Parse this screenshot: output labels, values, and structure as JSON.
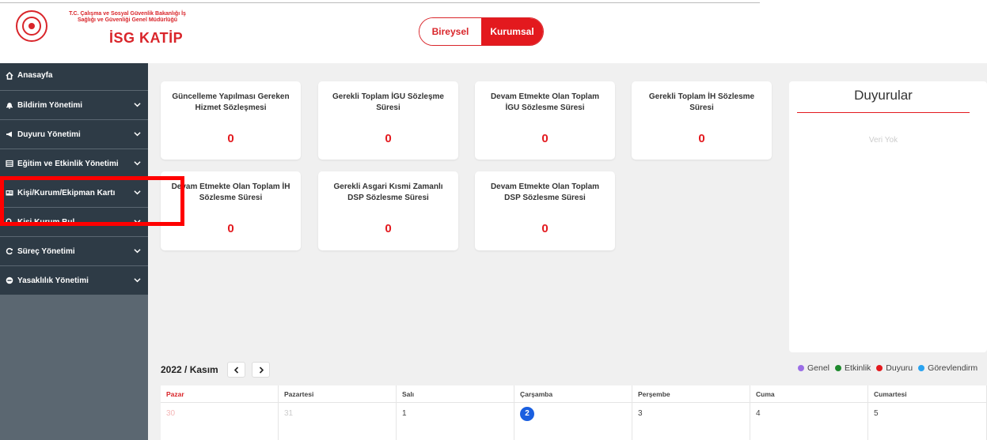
{
  "header": {
    "ministry_line1": "T.C. Çalışma ve Sosyal Güvenlik Bakanlığı İş",
    "ministry_line2": "Sağlığı ve Güvenliği Genel Müdürlüğü",
    "brand": "İSG KATİP",
    "switch": {
      "option1": "Bireysel",
      "option2": "Kurumsal",
      "active": "Kurumsal"
    }
  },
  "sidebar": {
    "items": [
      {
        "label": "Anasayfa",
        "icon": "home-icon"
      },
      {
        "label": "Bildirim Yönetimi",
        "icon": "bell-icon"
      },
      {
        "label": "Duyuru Yönetimi",
        "icon": "megaphone-icon"
      },
      {
        "label": "Eğitim ve Etkinlik Yönetimi",
        "icon": "calendar-grid-icon"
      },
      {
        "label": "Kişi/Kurum/Ekipman Kartı",
        "icon": "id-card-icon"
      },
      {
        "label": "Kişi Kurum Bul",
        "icon": "search-icon"
      },
      {
        "label": "Süreç Yönetimi",
        "icon": "refresh-icon"
      },
      {
        "label": "Yasaklılık Yönetimi",
        "icon": "minus-circle-icon"
      }
    ]
  },
  "stats": [
    {
      "title": "Güncelleme Yapılması Gereken Hizmet Sözleşmesi",
      "value": "0"
    },
    {
      "title": "Gerekli Toplam İGU Sözleşme Süresi",
      "value": "0"
    },
    {
      "title": "Devam Etmekte Olan Toplam İGU Sözlesme Süresi",
      "value": "0"
    },
    {
      "title": "Gerekli Toplam İH Sözlesme Süresi",
      "value": "0"
    },
    {
      "title": "Devam Etmekte Olan Toplam İH Sözlesme Süresi",
      "value": "0"
    },
    {
      "title": "Gerekli Asgari Kısmi Zamanlı DSP Sözlesme Süresi",
      "value": "0"
    },
    {
      "title": "Devam Etmekte Olan Toplam DSP Sözlesme Süresi",
      "value": "0"
    }
  ],
  "announcements": {
    "title": "Duyurular",
    "empty_text": "Veri Yok"
  },
  "legend": [
    {
      "label": "Genel",
      "color": "#9b6ee6"
    },
    {
      "label": "Etkinlik",
      "color": "#1f8a2e"
    },
    {
      "label": "Duyuru",
      "color": "#e3191e"
    },
    {
      "label": "Görevlendirm",
      "color": "#2aa3f0"
    }
  ],
  "calendar": {
    "title": "2022 / Kasım",
    "prev": "‹",
    "next": "›",
    "days": [
      "Pazar",
      "Pazartesi",
      "Salı",
      "Çarşamba",
      "Perşembe",
      "Cuma",
      "Cumartesi"
    ],
    "dates": [
      "30",
      "31",
      "1",
      "2",
      "3",
      "4",
      "5"
    ],
    "today": "2"
  },
  "colors": {
    "brand_red": "#e3191e",
    "sidebar_dark": "#2e3b46",
    "sidebar_bg": "#5b6771",
    "highlight_box": "#ff0000",
    "today_blue": "#1a5fe0"
  }
}
